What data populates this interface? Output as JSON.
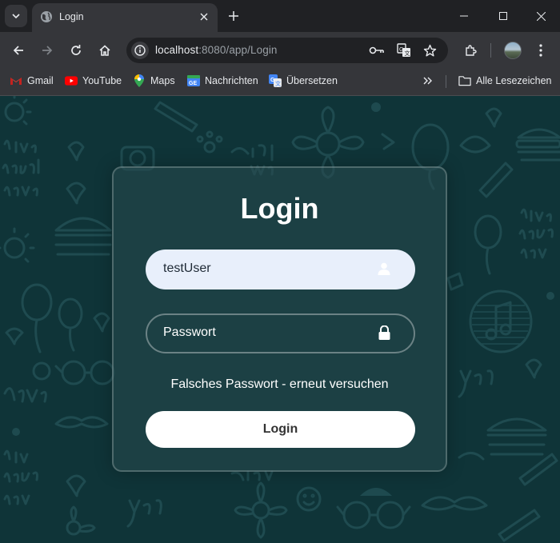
{
  "browser": {
    "tab": {
      "title": "Login"
    },
    "url": {
      "host": "localhost",
      "rest": ":8080/app/Login"
    },
    "bookmarks": [
      {
        "label": "Gmail",
        "icon": "gmail-icon"
      },
      {
        "label": "YouTube",
        "icon": "youtube-icon"
      },
      {
        "label": "Maps",
        "icon": "maps-icon"
      },
      {
        "label": "Nachrichten",
        "icon": "news-icon"
      },
      {
        "label": "Übersetzen",
        "icon": "translate-icon"
      }
    ],
    "all_bookmarks_label": "Alle Lesezeichen"
  },
  "login": {
    "title": "Login",
    "username_value": "testUser",
    "password_placeholder": "Passwort",
    "error": "Falsches Passwort - erneut versuchen",
    "submit_label": "Login"
  },
  "colors": {
    "page_background": "#0f3438",
    "card_border": "rgba(255,255,255,0.22)",
    "input_filled": "#e8effb",
    "button": "#ffffff",
    "chrome_dark": "#202124",
    "chrome_toolbar": "#35363a"
  }
}
